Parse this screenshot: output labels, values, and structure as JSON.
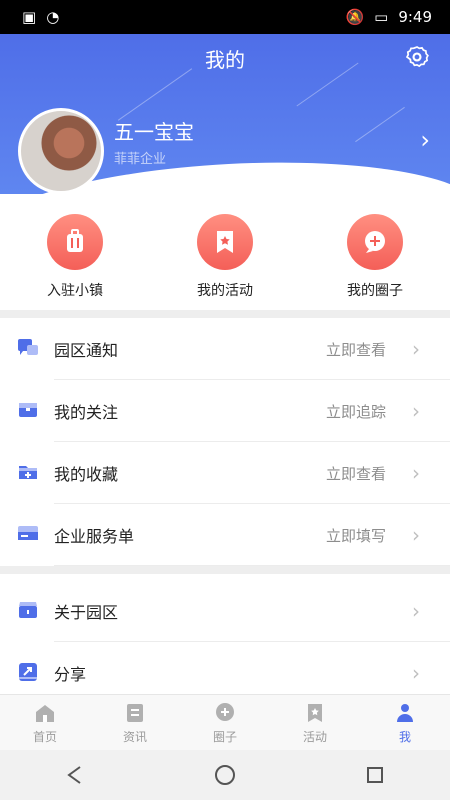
{
  "status": {
    "time": "9:49"
  },
  "header": {
    "title": "我的"
  },
  "profile": {
    "name": "五一宝宝",
    "company": "菲菲企业"
  },
  "quick_actions": [
    {
      "label": "入驻小镇",
      "icon": "luggage-icon"
    },
    {
      "label": "我的活动",
      "icon": "bookmark-star-icon"
    },
    {
      "label": "我的圈子",
      "icon": "chat-plus-icon"
    }
  ],
  "menu1": [
    {
      "label": "园区通知",
      "action": "立即查看",
      "icon": "notification-chat-icon"
    },
    {
      "label": "我的关注",
      "action": "立即追踪",
      "icon": "box-icon"
    },
    {
      "label": "我的收藏",
      "action": "立即查看",
      "icon": "folder-plus-icon"
    },
    {
      "label": "企业服务单",
      "action": "立即填写",
      "icon": "card-icon"
    }
  ],
  "menu2": [
    {
      "label": "关于园区",
      "icon": "store-icon"
    },
    {
      "label": "分享",
      "icon": "share-icon"
    }
  ],
  "tabs": [
    {
      "label": "首页",
      "icon": "home-icon"
    },
    {
      "label": "资讯",
      "icon": "news-icon"
    },
    {
      "label": "圈子",
      "icon": "circle-chat-icon"
    },
    {
      "label": "活动",
      "icon": "activity-icon"
    },
    {
      "label": "我",
      "icon": "user-icon",
      "active": true
    }
  ],
  "colors": {
    "primary": "#4f6ee8",
    "accent": "#f45f58"
  }
}
